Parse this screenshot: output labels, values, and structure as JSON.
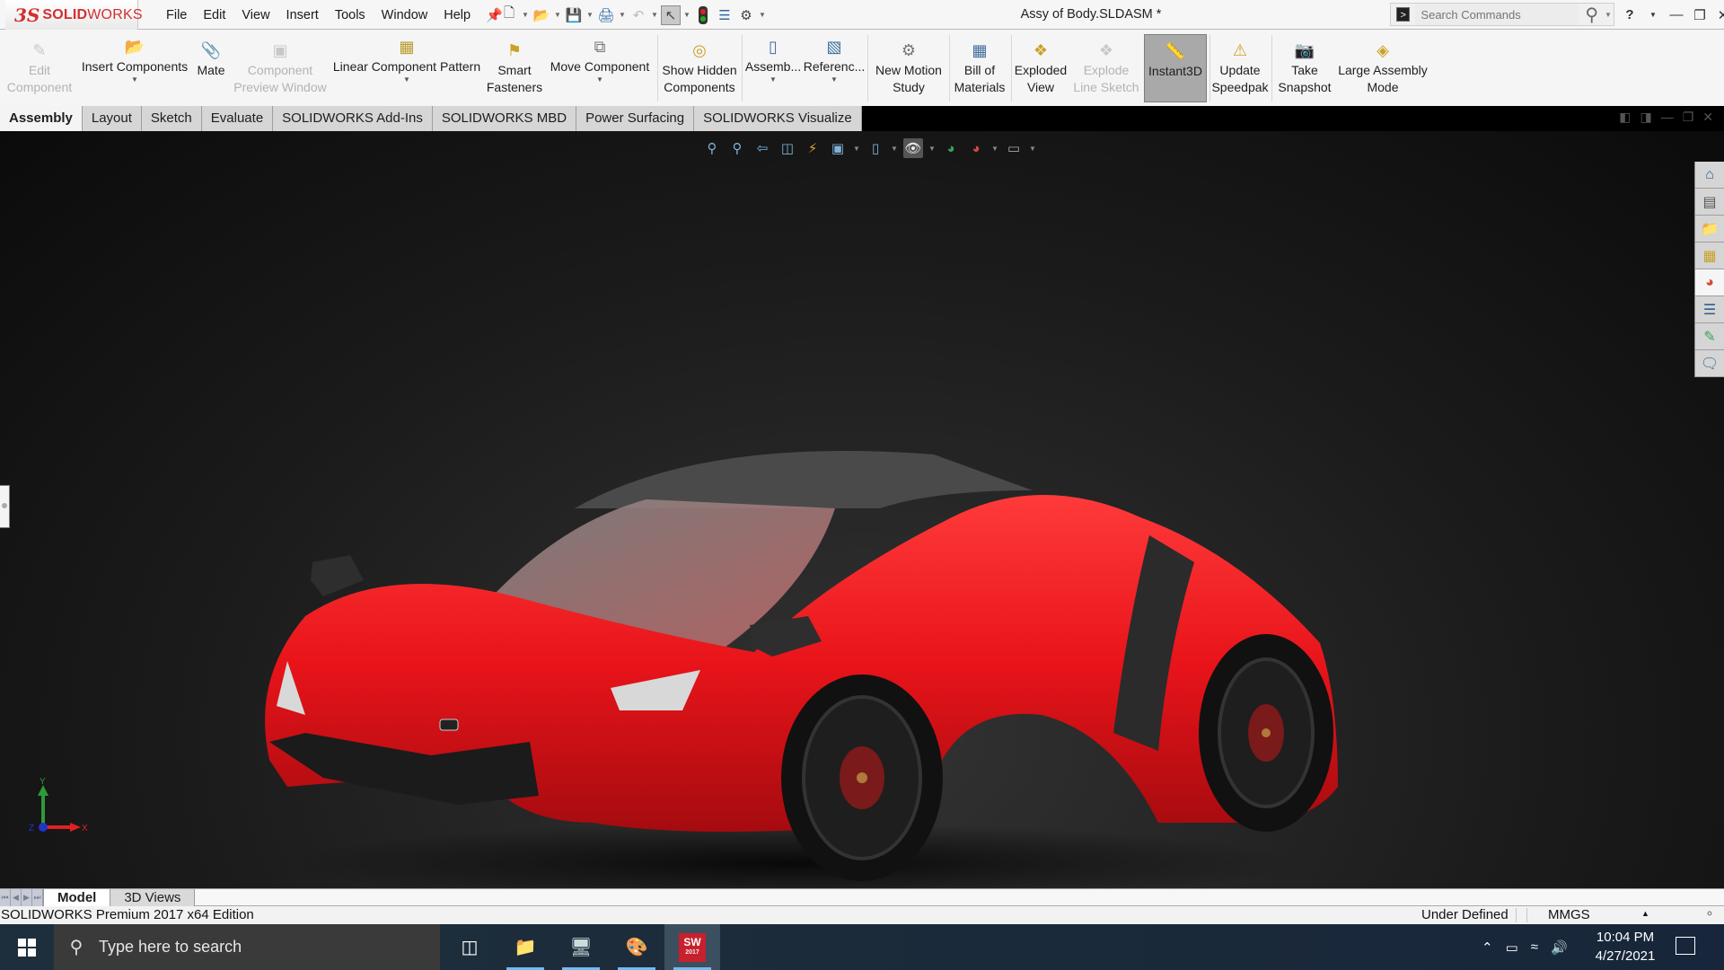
{
  "app": {
    "brand_ds": "3S",
    "brand_name_bold": "SOLID",
    "brand_name_light": "WORKS",
    "document_title": "Assy of Body.SLDASM *"
  },
  "menu": [
    "File",
    "Edit",
    "View",
    "Insert",
    "Tools",
    "Window",
    "Help"
  ],
  "search": {
    "placeholder": "Search Commands"
  },
  "ribbon": {
    "commands": [
      {
        "label": "Edit Component",
        "enabled": false,
        "icon": "edit-component-icon"
      },
      {
        "label": "Insert Components",
        "enabled": true,
        "icon": "insert-components-icon",
        "has_dropdown": true
      },
      {
        "label": "Mate",
        "enabled": true,
        "icon": "mate-paperclip-icon"
      },
      {
        "label": "Component Preview Window",
        "enabled": false,
        "icon": "component-preview-icon"
      },
      {
        "label": "Linear Component Pattern",
        "enabled": true,
        "icon": "linear-pattern-icon",
        "has_dropdown": true
      },
      {
        "label": "Smart Fasteners",
        "enabled": true,
        "icon": "smart-fasteners-icon"
      },
      {
        "label": "Move Component",
        "enabled": true,
        "icon": "move-component-icon",
        "has_dropdown": true
      },
      {
        "label": "Show Hidden Components",
        "enabled": true,
        "icon": "show-hidden-icon"
      },
      {
        "label": "Assemb...",
        "enabled": true,
        "icon": "assembly-features-icon",
        "has_dropdown": true
      },
      {
        "label": "Referenc...",
        "enabled": true,
        "icon": "reference-geometry-icon",
        "has_dropdown": true
      },
      {
        "label": "New Motion Study",
        "enabled": true,
        "icon": "motion-study-icon"
      },
      {
        "label": "Bill of Materials",
        "enabled": true,
        "icon": "bill-of-materials-icon"
      },
      {
        "label": "Exploded View",
        "enabled": true,
        "icon": "exploded-view-icon"
      },
      {
        "label": "Explode Line Sketch",
        "enabled": false,
        "icon": "explode-line-sketch-icon"
      },
      {
        "label": "Instant3D",
        "enabled": true,
        "active": true,
        "icon": "instant3d-icon"
      },
      {
        "label": "Update Speedpak",
        "enabled": true,
        "icon": "update-speedpak-icon"
      },
      {
        "label": "Take Snapshot",
        "enabled": true,
        "icon": "camera-icon"
      },
      {
        "label": "Large Assembly Mode",
        "enabled": true,
        "icon": "large-assembly-icon"
      }
    ]
  },
  "tabs": [
    "Assembly",
    "Layout",
    "Sketch",
    "Evaluate",
    "SOLIDWORKS Add-Ins",
    "SOLIDWORKS MBD",
    "Power Surfacing",
    "SOLIDWORKS Visualize"
  ],
  "active_tab": "Assembly",
  "triad": {
    "x": "X",
    "y": "Y",
    "z": "Z"
  },
  "bottom_tabs": [
    "Model",
    "3D Views"
  ],
  "status": {
    "edition": "SOLIDWORKS Premium 2017 x64 Edition",
    "definition": "Under Defined",
    "units": "MMGS"
  },
  "taskbar": {
    "search_placeholder": "Type here to search",
    "sw_badge_top": "SW",
    "sw_badge_year": "2017",
    "time": "10:04 PM",
    "date": "4/27/2021"
  },
  "colors": {
    "brand_red": "#d32f2f",
    "car_red": "#e8141a",
    "viewport_bg": "#1b1b1b",
    "taskbar_bg": "#1d2f3c"
  }
}
